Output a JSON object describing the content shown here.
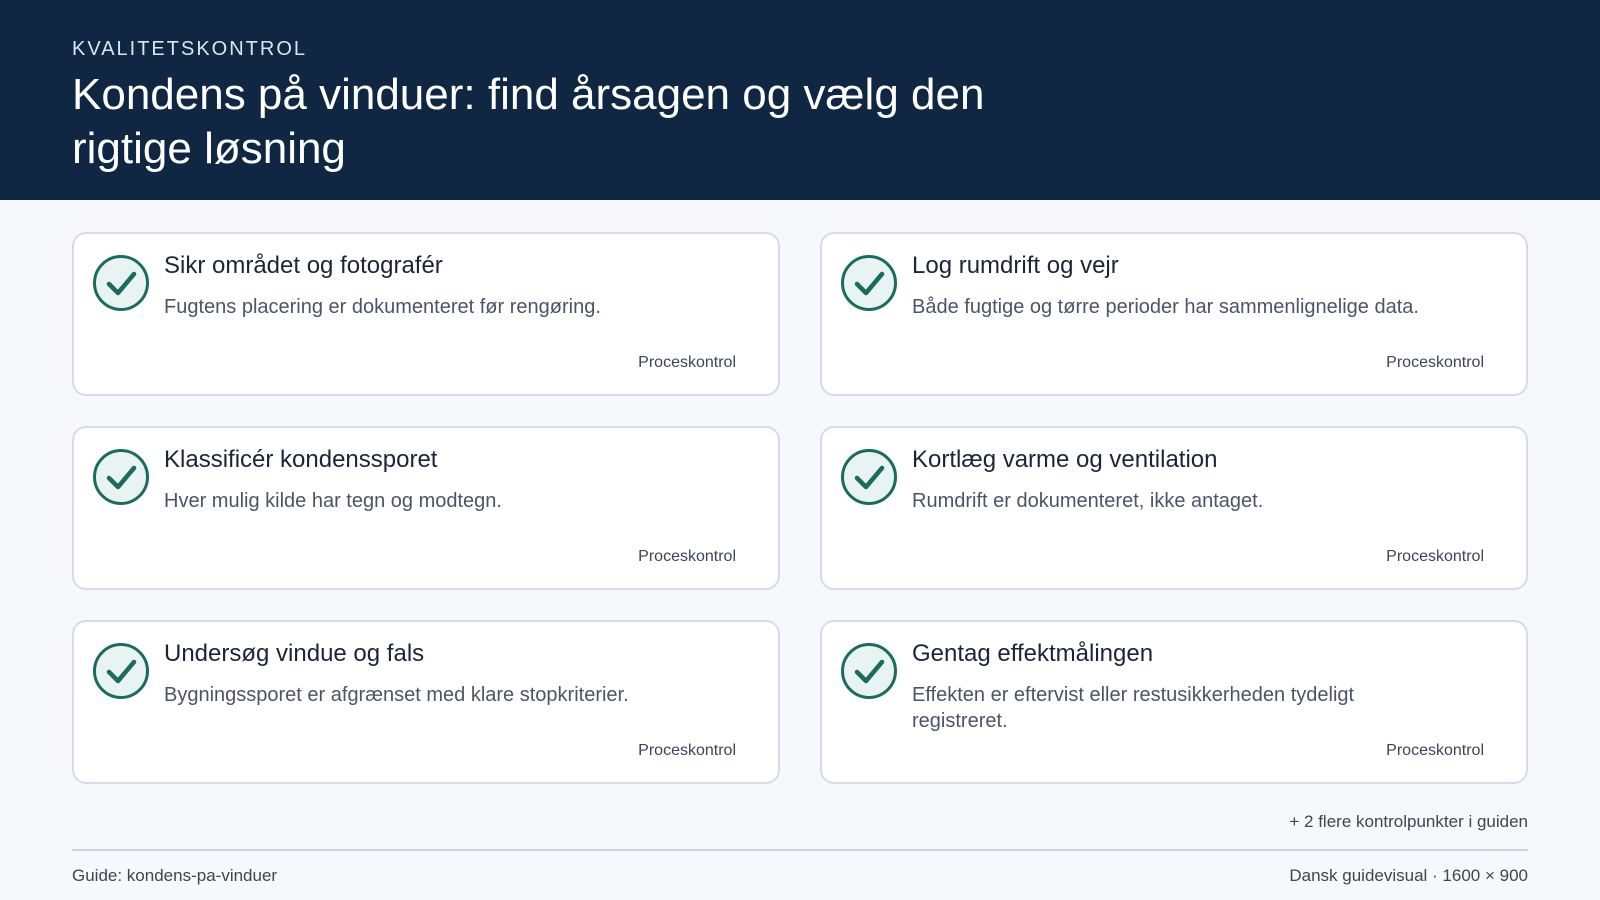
{
  "header": {
    "eyebrow": "KVALITETSKONTROL",
    "title": "Kondens på vinduer: find årsagen og vælg den rigtige løsning"
  },
  "cards": [
    {
      "title": "Sikr området og fotografér",
      "description": "Fugtens placering er dokumenteret før rengøring.",
      "tag": "Proceskontrol",
      "icon": "check-circle-icon"
    },
    {
      "title": "Log rumdrift og vejr",
      "description": "Både fugtige og tørre perioder har sammenlignelige data.",
      "tag": "Proceskontrol",
      "icon": "check-circle-icon"
    },
    {
      "title": "Klassificér kondenssporet",
      "description": "Hver mulig kilde har tegn og modtegn.",
      "tag": "Proceskontrol",
      "icon": "check-circle-icon"
    },
    {
      "title": "Kortlæg varme og ventilation",
      "description": "Rumdrift er dokumenteret, ikke antaget.",
      "tag": "Proceskontrol",
      "icon": "check-circle-icon"
    },
    {
      "title": "Undersøg vindue og fals",
      "description": "Bygningssporet er afgrænset med klare stopkriterier.",
      "tag": "Proceskontrol",
      "icon": "check-circle-icon"
    },
    {
      "title": "Gentag effektmålingen",
      "description": "Effekten er eftervist eller restusikkerheden tydeligt registreret.",
      "tag": "Proceskontrol",
      "icon": "check-circle-icon"
    }
  ],
  "more_link": "+ 2 flere kontrolpunkter i guiden",
  "footer": {
    "left": "Guide: kondens-pa-vinduer",
    "right": "Dansk guidevisual · 1600 × 900"
  },
  "colors": {
    "header_bg": "#0f2743",
    "accent": "#1b6b5f",
    "icon_fill": "#e8f4f1",
    "card_border": "#d3dde8"
  }
}
